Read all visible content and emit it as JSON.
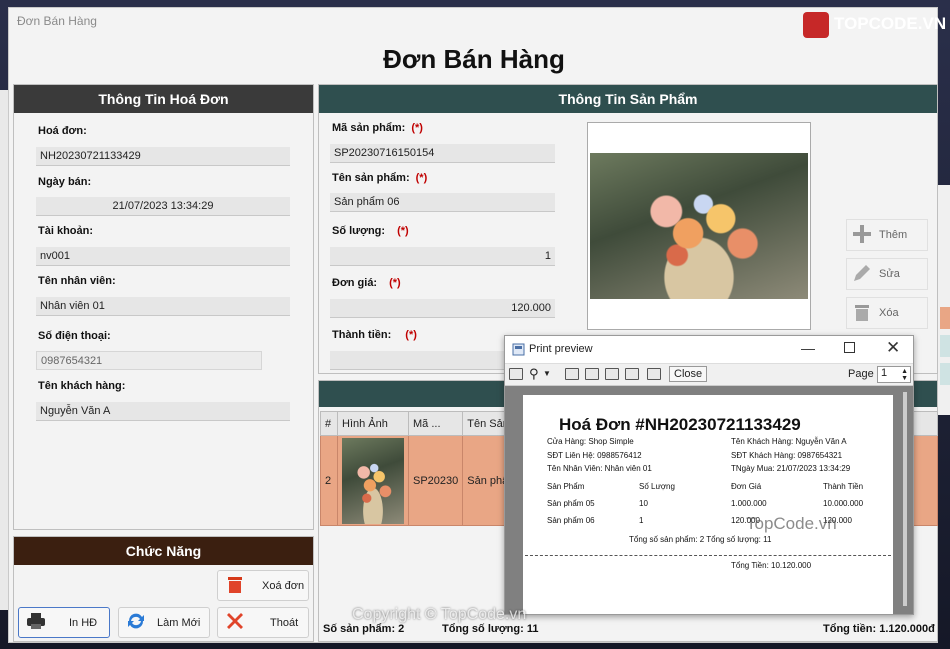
{
  "window": {
    "title": "Đơn Bán Hàng",
    "heading": "Đơn Bán Hàng"
  },
  "invoice_info": {
    "header": "Thông Tin Hoá Đơn",
    "fields": [
      {
        "label": "Hoá đơn:",
        "value": "NH20230721133429"
      },
      {
        "label": "Ngày bán:",
        "value": "21/07/2023 13:34:29"
      },
      {
        "label": "Tài khoản:",
        "value": "nv001"
      },
      {
        "label": "Tên nhân viên:",
        "value": "Nhân viên 01"
      },
      {
        "label": "Số điện thoại:",
        "value": "0987654321"
      },
      {
        "label": "Tên khách hàng:",
        "value": "Nguyễn Văn A"
      }
    ]
  },
  "product_info": {
    "header": "Thông Tin Sản Phẩm",
    "required_mark": "(*)",
    "fields": [
      {
        "label": "Mã sản phẩm:",
        "value": "SP20230716150154"
      },
      {
        "label": "Tên sản phẩm:",
        "value": "Sản phẩm 06"
      },
      {
        "label": "Số lượng:",
        "value": "1"
      },
      {
        "label": "Đơn giá:",
        "value": "120.000"
      },
      {
        "label": "Thành tiền:",
        "value": ""
      }
    ],
    "buttons": {
      "add": "Thêm",
      "edit": "Sửa",
      "delete": "Xóa"
    }
  },
  "functions": {
    "header": "Chức Năng",
    "delete_invoice": "Xoá đơn",
    "print": "In HĐ",
    "refresh": "Làm Mới",
    "exit": "Thoát"
  },
  "grid": {
    "columns": [
      "#",
      "Hình Ảnh",
      "Mã ...",
      "Tên Sản Phẩ"
    ],
    "rows": [
      {
        "index": "2",
        "code": "SP20230",
        "name": "Sản phẩm 06"
      }
    ]
  },
  "summary": {
    "count_label": "Số sản phẩm: 2",
    "qty_label": "Tổng số lượng: 11",
    "total_label": "Tổng tiền: 1.120.000đ"
  },
  "print_preview": {
    "title": "Print preview",
    "close": "Close",
    "page_label": "Page",
    "page_value": "1",
    "receipt": {
      "title": "Hoá Đơn #NH20230721133429",
      "store": "Cửa Hàng: Shop Simple",
      "phone": "SĐT Liên Hệ: 0988576412",
      "employee": "Tên Nhân Viên: Nhân viên 01",
      "customer": "Tên Khách Hàng: Nguyễn Văn A",
      "customer_phone": "SĐT Khách Hàng: 0987654321",
      "date": "TNgày Mua: 21/07/2023 13:34:29",
      "columns": [
        "Sản Phẩm",
        "Số Lượng",
        "Đơn Giá",
        "Thành Tiền"
      ],
      "items": [
        {
          "name": "Sản phẩm 05",
          "qty": "10",
          "price": "1.000.000",
          "total": "10.000.000"
        },
        {
          "name": "Sản phẩm 06",
          "qty": "1",
          "price": "120.000",
          "total": "120.000"
        }
      ],
      "totals_line": "Tổng số sản phẩm: 2  Tổng số lượng: 11",
      "grand_total": "Tổng Tiền: 10.120.000"
    }
  },
  "watermarks": {
    "logo": "TOPCODE.VN",
    "center": "TopCode.vn",
    "copyright": "Copyright © TopCode.vn"
  },
  "colors": {
    "invoice_header": "#3a3a3a",
    "product_header": "#2f4f4f",
    "function_header": "#3b1f10",
    "selected_row": "#e9a685",
    "required": "#c00000"
  }
}
